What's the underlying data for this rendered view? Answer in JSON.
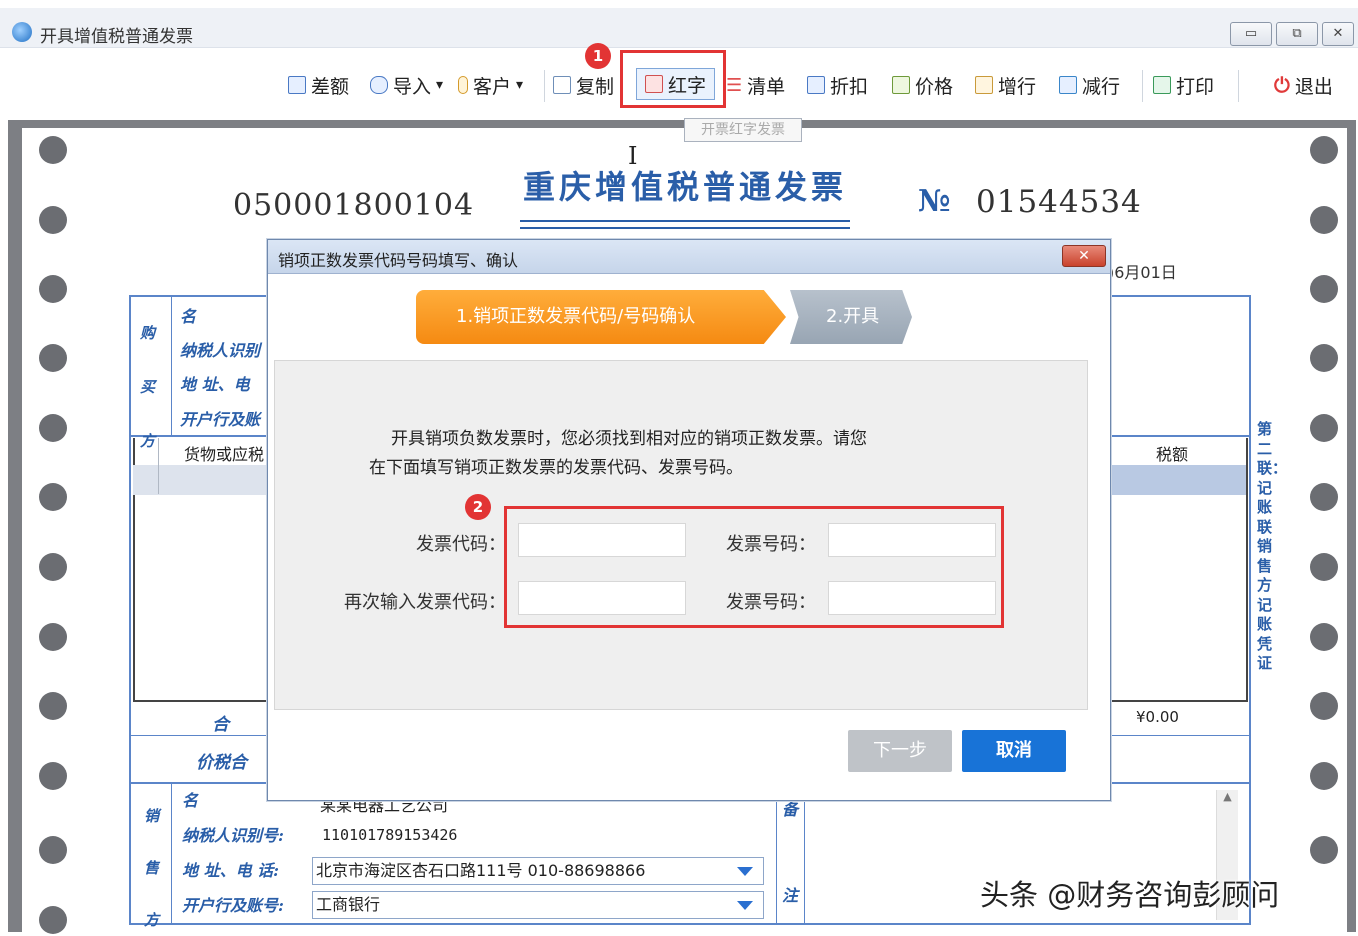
{
  "window": {
    "title": "开具增值税普通发票",
    "minimize": "▭",
    "restore": "⧉",
    "close": "✕"
  },
  "toolbar": {
    "items": [
      {
        "label": "差额",
        "icon": "difference-icon"
      },
      {
        "label": "导入",
        "icon": "import-icon",
        "dropdown": "▾"
      },
      {
        "label": "客户",
        "icon": "customer-icon",
        "dropdown": "▾"
      },
      {
        "label": "复制",
        "icon": "copy-icon"
      },
      {
        "label": "红字",
        "icon": "red-invoice-icon"
      },
      {
        "label": "清单",
        "icon": "list-icon"
      },
      {
        "label": "折扣",
        "icon": "discount-icon"
      },
      {
        "label": "价格",
        "icon": "price-icon"
      },
      {
        "label": "增行",
        "icon": "add-row-icon"
      },
      {
        "label": "减行",
        "icon": "remove-row-icon"
      },
      {
        "label": "打印",
        "icon": "print-icon"
      },
      {
        "label": "退出",
        "icon": "power-icon"
      }
    ],
    "tooltip": "开票红字发票",
    "marker_1": "1"
  },
  "invoice": {
    "code": "050001800104",
    "title": "重庆增值税普通发票",
    "no_mark": "№",
    "number": "01544534",
    "date_fragment": ")6月01日",
    "buyer_section": "购 买 方",
    "buyer_rows": [
      "名",
      "纳税人识别",
      "地 址、电",
      "开户行及账"
    ],
    "goods_header": "货物或应税",
    "tax_header": "税额",
    "total_label": "合",
    "total_amount": "¥0.00",
    "price_tax_total": "价税合",
    "seller_section": "销 售 方",
    "seller_name_fragment": "某某电器工艺公司",
    "seller_rows": [
      "名",
      "纳税人识别号:",
      "地 址、电 话:",
      "开户行及账号:"
    ],
    "seller_tax_id": "110101789153426",
    "seller_address": "北京市海淀区杏石口路111号 010-88698866",
    "seller_bank": "工商银行",
    "remark_chars": [
      "备",
      "注"
    ],
    "side_label": "第二联：记账联 销售方记账凭证"
  },
  "dialog": {
    "title": "销项正数发票代码号码填写、确认",
    "close": "✕",
    "step1": "1.销项正数发票代码/号码确认",
    "step2": "2.开具",
    "message_line1": "开具销项负数发票时，您必须找到相对应的销项正数发票。请您",
    "message_line2": "在下面填写销项正数发票的发票代码、发票号码。",
    "marker_2": "2",
    "fields": {
      "code_label": "发票代码：",
      "number_label": "发票号码：",
      "code_again_label": "再次输入发票代码：",
      "number_again_label": "发票号码：",
      "code_value": "",
      "number_value": "",
      "code_again_value": "",
      "number_again_value": ""
    },
    "next_button": "下一步",
    "cancel_button": "取消"
  },
  "watermark": "头条 @财务咨询彭顾问",
  "colors": {
    "accent_red": "#e23434",
    "step_orange": "#f58a12",
    "primary_blue": "#1873d7",
    "invoice_blue": "#2a5ea8"
  }
}
